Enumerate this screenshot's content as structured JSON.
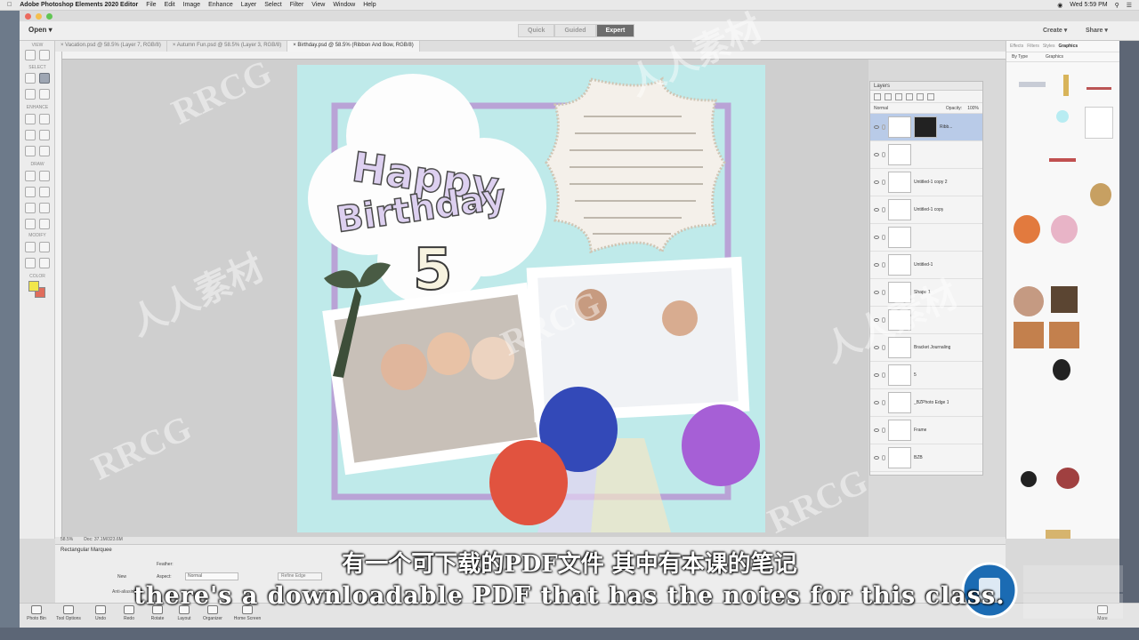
{
  "menubar": {
    "app_name": "Adobe Photoshop Elements 2020 Editor",
    "items": [
      "File",
      "Edit",
      "Image",
      "Enhance",
      "Layer",
      "Select",
      "Filter",
      "View",
      "Window",
      "Help"
    ],
    "clock": "Wed 5:59 PM"
  },
  "header": {
    "open_label": "Open",
    "modes": [
      "Quick",
      "Guided",
      "Expert"
    ],
    "active_mode": "Expert",
    "create_label": "Create",
    "share_label": "Share"
  },
  "toolbar": {
    "sections": [
      "VIEW",
      "SELECT",
      "ENHANCE",
      "DRAW",
      "MODIFY",
      "COLOR"
    ]
  },
  "document_tabs": [
    "Vacation.psd @ 58.5% (Layer 7, RGB/8)",
    "Autumn Fun.psd @ 58.5% (Layer 3, RGB/8)",
    "Birthday.psd @ 58.5% (Ribbon And Bow, RGB/8)"
  ],
  "status": {
    "zoom": "58.5%",
    "doc": "Doc: 37.1M/323.6M"
  },
  "artwork": {
    "line1": "Happy",
    "line2": "Birthday",
    "number": "5"
  },
  "layers_panel": {
    "title": "Layers",
    "blend_mode": "Normal",
    "opacity_label": "Opacity:",
    "opacity_value": "100%",
    "layers": [
      {
        "name": "Ribb...",
        "active": true
      },
      {
        "name": "",
        "active": false
      },
      {
        "name": "Untitled-1 copy 2",
        "active": false
      },
      {
        "name": "Untitled-1 copy",
        "active": false
      },
      {
        "name": "",
        "active": false
      },
      {
        "name": "Untitled-1",
        "active": false
      },
      {
        "name": "Shape 1",
        "active": false
      },
      {
        "name": "",
        "active": false
      },
      {
        "name": "Bracket Journaling",
        "active": false
      },
      {
        "name": "5",
        "active": false
      },
      {
        "name": "_BZPhoto Edge 1",
        "active": false
      },
      {
        "name": "Frame",
        "active": false
      },
      {
        "name": "BZB",
        "active": false
      }
    ]
  },
  "graphics_panel": {
    "tabs": [
      "Effects",
      "Filters",
      "Styles",
      "Graphics"
    ],
    "active_tab": "Graphics",
    "filter_by": "By Type",
    "filter_value": "Graphics"
  },
  "options_bar": {
    "tool_name": "Rectangular Marquee",
    "new_label": "New",
    "feather_label": "Feather:",
    "aspect_label": "Aspect:",
    "aspect_value": "Normal",
    "refine_edge": "Refine Edge",
    "antialias": "Anti-aliasing"
  },
  "taskbar": {
    "items": [
      "Photo Bin",
      "Tool Options",
      "Undo",
      "Redo",
      "Rotate",
      "Layout",
      "Organizer",
      "Home Screen"
    ],
    "more_label": "More"
  },
  "subtitles": {
    "chinese": "有一个可下载的PDF文件 其中有本课的笔记",
    "english": "there's a downloadable PDF that has the notes for this class."
  },
  "watermark": {
    "text": "RRCG",
    "cn_text": "人人素材"
  },
  "colors": {
    "artboard_bg": "#bfeaea",
    "active_mode_bg": "#6d6d6d",
    "foreground_color": "#f1e64a",
    "background_color": "#e06d5c"
  }
}
